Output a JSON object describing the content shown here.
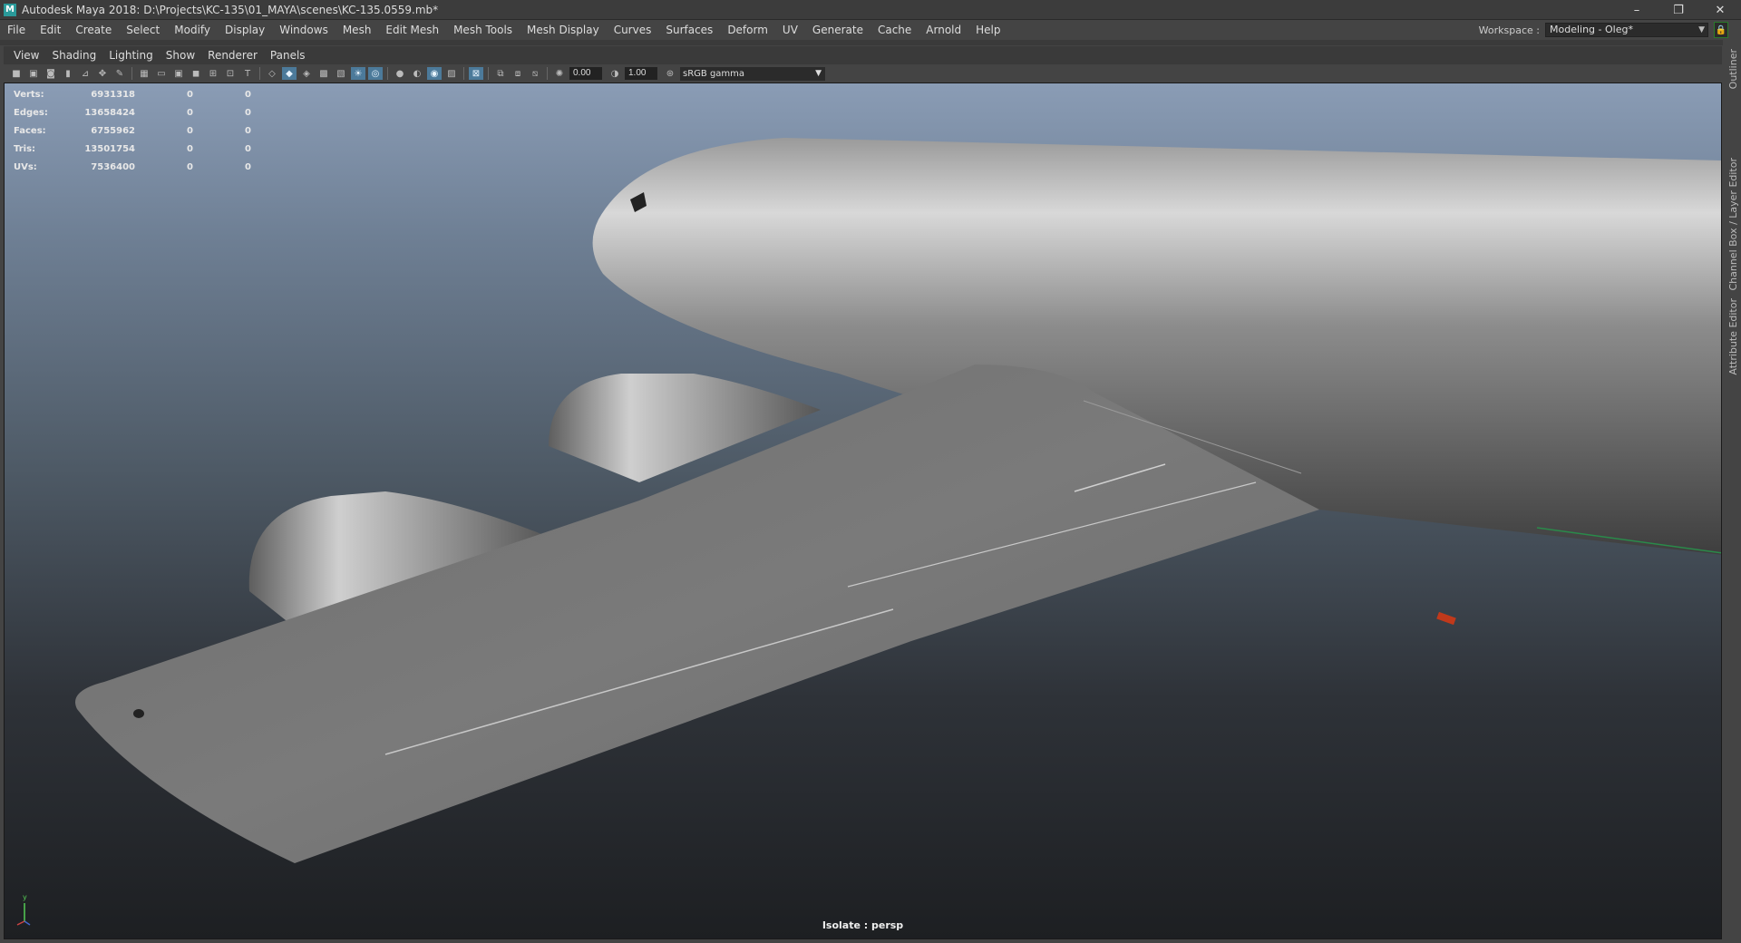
{
  "window": {
    "title": "Autodesk Maya 2018: D:\\Projects\\KC-135\\01_MAYA\\scenes\\KC-135.0559.mb*",
    "app_icon": "M",
    "controls": {
      "minimize": "–",
      "restore": "❐",
      "close": "✕"
    }
  },
  "menu": {
    "items": [
      "File",
      "Edit",
      "Create",
      "Select",
      "Modify",
      "Display",
      "Windows",
      "Mesh",
      "Edit Mesh",
      "Mesh Tools",
      "Mesh Display",
      "Curves",
      "Surfaces",
      "Deform",
      "UV",
      "Generate",
      "Cache",
      "Arnold",
      "Help"
    ],
    "workspace_label": "Workspace :",
    "workspace_value": "Modeling - Oleg*"
  },
  "panel": {
    "menu": [
      "View",
      "Shading",
      "Lighting",
      "Show",
      "Renderer",
      "Panels"
    ],
    "exposure": "0.00",
    "gamma": "1.00",
    "color_space": "sRGB gamma"
  },
  "hud": {
    "rows": [
      {
        "label": "Verts:",
        "value": "6931318",
        "c1": "0",
        "c2": "0"
      },
      {
        "label": "Edges:",
        "value": "13658424",
        "c1": "0",
        "c2": "0"
      },
      {
        "label": "Faces:",
        "value": "6755962",
        "c1": "0",
        "c2": "0"
      },
      {
        "label": "Tris:",
        "value": "13501754",
        "c1": "0",
        "c2": "0"
      },
      {
        "label": "UVs:",
        "value": "7536400",
        "c1": "0",
        "c2": "0"
      }
    ]
  },
  "viewport": {
    "status": "Isolate : persp",
    "axis_label": "y"
  },
  "side_tabs": [
    "Outliner",
    "Channel Box / Layer Editor",
    "Attribute Editor"
  ],
  "colors": {
    "accent": "#4c7a9a",
    "background_top": "#8a9cb5",
    "background_bottom": "#1d1f22"
  }
}
